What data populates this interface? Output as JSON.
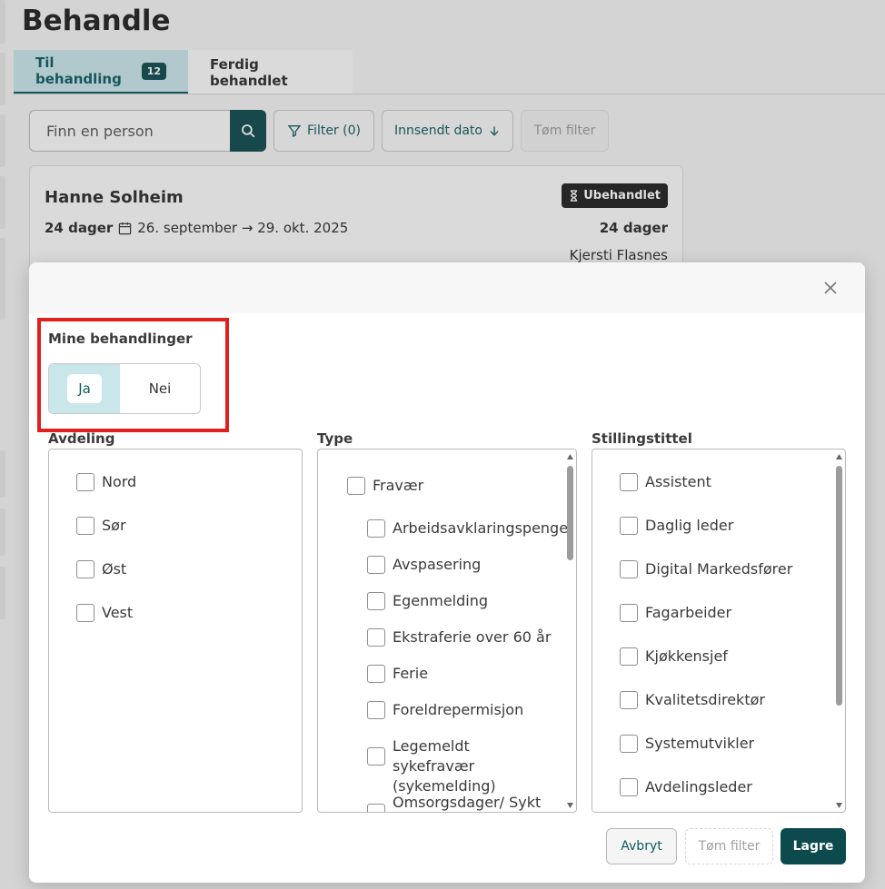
{
  "page": {
    "title": "Behandle",
    "tabs": [
      {
        "label": "Til behandling",
        "badge": "12"
      },
      {
        "label": "Ferdig behandlet"
      }
    ],
    "search": {
      "placeholder": "Finn en person"
    },
    "toolbar": {
      "filter_label": "Filter (0)",
      "date_label": "Innsendt dato",
      "clear_label": "Tøm filter"
    },
    "card": {
      "name": "Hanne Solheim",
      "status": "Ubehandlet",
      "days": "24 dager",
      "date_range": "26. september → 29. okt. 2025",
      "days_right": "24 dager",
      "person": "Kjersti Flasnes",
      "bottom_person": "Kjersti Flasnes"
    }
  },
  "modal": {
    "mine": {
      "label": "Mine behandlinger",
      "yes": "Ja",
      "no": "Nei",
      "selected": "Ja"
    },
    "avdeling": {
      "label": "Avdeling",
      "items": [
        "Nord",
        "Sør",
        "Øst",
        "Vest"
      ]
    },
    "type": {
      "label": "Type",
      "parent": "Fravær",
      "items": [
        "Arbeidsavklaringspenge",
        "Avspasering",
        "Egenmelding",
        "Ekstraferie over 60 år",
        "Ferie",
        "Foreldrepermisjon",
        "Legemeldt sykefravær (sykemelding)",
        "Omsorgsdager/ Sykt"
      ]
    },
    "stilling": {
      "label": "Stillingstittel",
      "items": [
        "Assistent",
        "Daglig leder",
        "Digital Markedsfører",
        "Fagarbeider",
        "Kjøkkensjef",
        "Kvalitetsdirektør",
        "Systemutvikler",
        "Avdelingsleder"
      ]
    },
    "buttons": {
      "cancel": "Avbryt",
      "clear": "Tøm filter",
      "save": "Lagre"
    }
  },
  "colors": {
    "brand": "#0d4a4e",
    "tab_active_bg": "#c9e6ea",
    "highlight": "#e01f1f"
  }
}
